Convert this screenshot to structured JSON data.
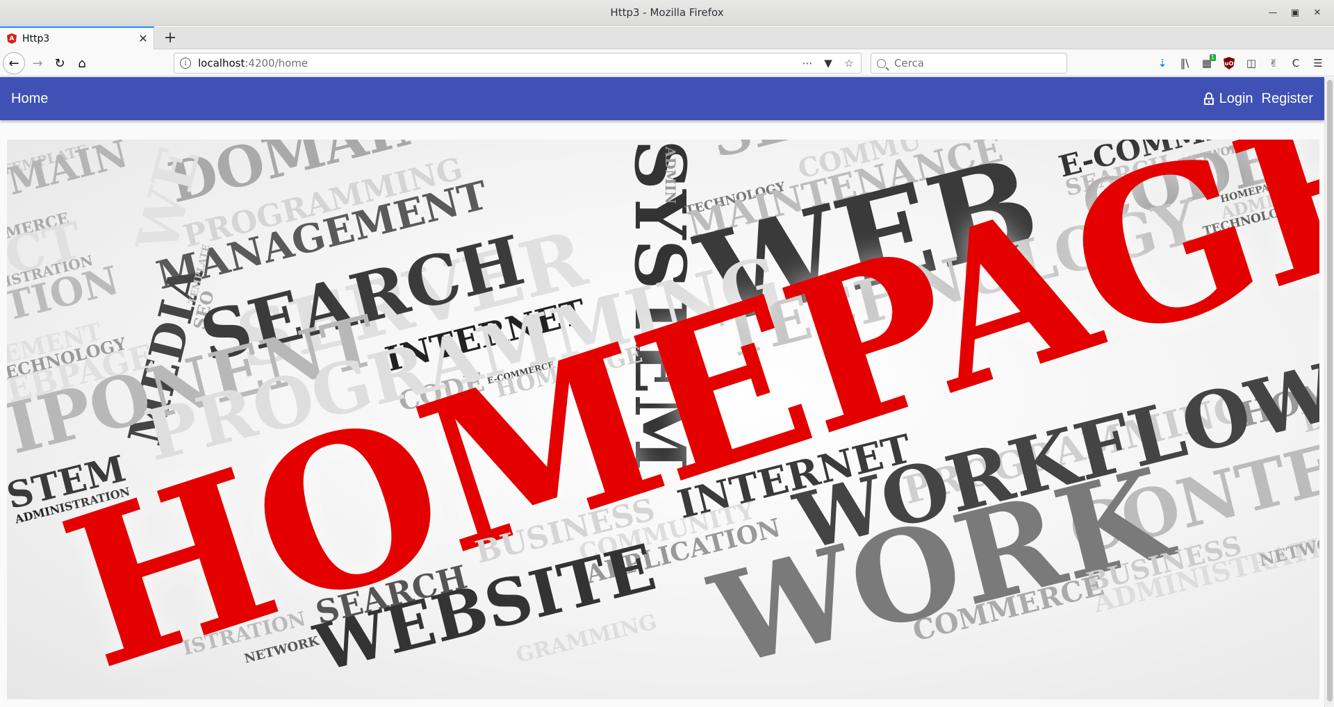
{
  "window": {
    "title": "Http3 - Mozilla Firefox"
  },
  "tab": {
    "title": "Http3",
    "favicon_letter": "A"
  },
  "urlbar": {
    "host": "localhost",
    "rest": ":4200/home"
  },
  "search": {
    "placeholder": "Cerca"
  },
  "toolbar": {
    "badge": "1"
  },
  "app": {
    "brand": "Home",
    "login": "Login",
    "register": "Register"
  },
  "wordcloud": {
    "w01": "TEMPLATE",
    "w02": "MAIN",
    "w03": "DOMAIN",
    "w04": "PROGRAMMING",
    "w05": "MANAGEMENT",
    "w06": "MEDIA",
    "w07": "WE",
    "w08": "SERVER",
    "w09": "SYSTEM",
    "w10": "ADMIN",
    "w11": "SEO",
    "w12": "TECHNOLOGY",
    "w13": "MAINTENANCE",
    "w14": "COMMU",
    "w15": "WEB",
    "w16": "E-COMMERCE",
    "w17": "SEARCH",
    "w18": "NETWORK",
    "w19": "CODE",
    "w20": "HOMEPAGE",
    "w21": "ADMIN",
    "w22": "TECHNOLOGY",
    "w23": "MERCE",
    "w24": "CT",
    "w25": "ISTRATION",
    "w26": "TION",
    "w27": "SEARCH",
    "w28": "INTERNET",
    "w29": "CODE",
    "w30": "E-COMMERCE",
    "w31": "HOMEPAGE",
    "w32": "TECHNOLOGY",
    "w33": "EMENT",
    "w34": "ECHNOLOGY",
    "w35": "EBPAGE",
    "w36": "IPONENT",
    "w37": "PROGRAMMING",
    "w38": "STEM",
    "w39": "ADMINISTRATION",
    "w40": "TEMPLATE",
    "w41": "HOMEPAGE",
    "w42": "PROGRAMMING",
    "w43": "HOME",
    "w44": "WORKFLOW",
    "w45": "INTERNET",
    "w46": "CONTENT",
    "w47": "BUSINESS",
    "w48": "COMMUNITY",
    "w49": "APPLICATION",
    "w50": "WORK",
    "w51": "SEARCH",
    "w52": "WEBSITE",
    "w53": "BUSINESS",
    "w54": "ADMINISTRATION",
    "w55": "NETWORK",
    "w56": "COMMERCE",
    "w57": "ISTRATION",
    "w58": "NETWORK",
    "w59": "GRAMMING",
    "w60": "SE",
    "w61": "D"
  }
}
